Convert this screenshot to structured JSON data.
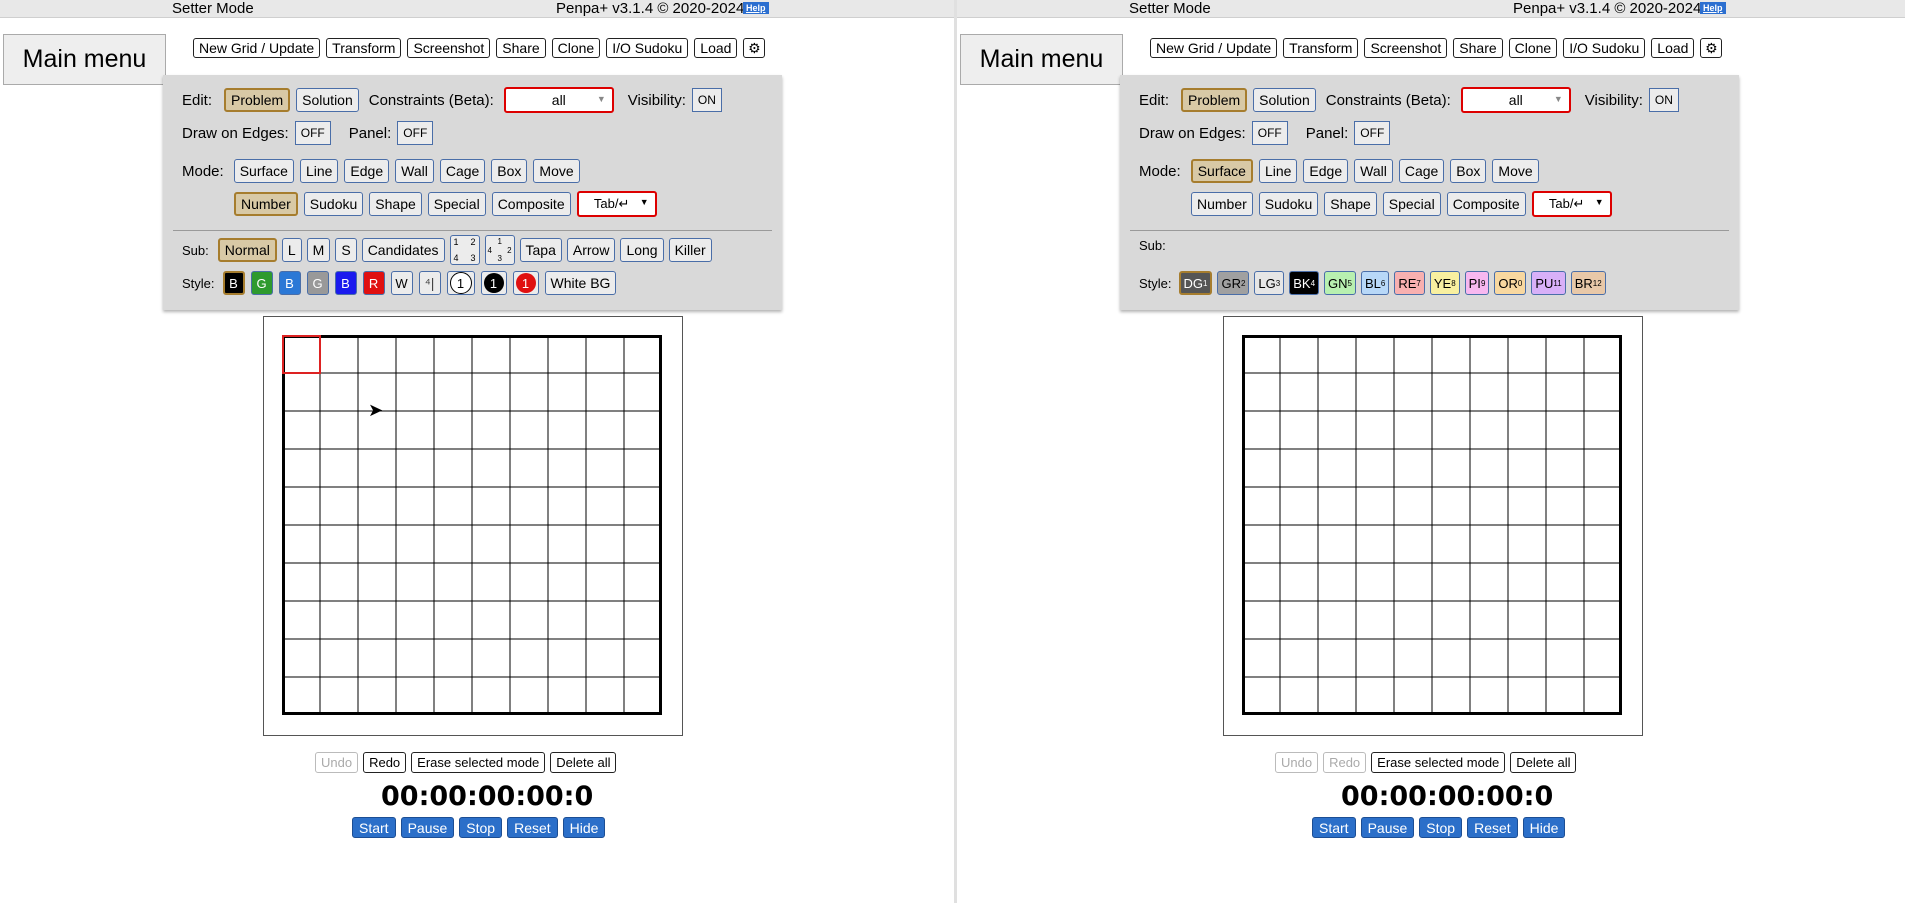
{
  "left": {
    "topbar": {
      "mode": "Setter Mode",
      "version": "Penpa+ v3.1.4 © 2020-2024",
      "help": "Help"
    },
    "main_menu": "Main menu",
    "toolbar": [
      "New Grid / Update",
      "Transform",
      "Screenshot",
      "Share",
      "Clone",
      "I/O Sudoku",
      "Load"
    ],
    "edit": {
      "label": "Edit:",
      "problem": "Problem",
      "solution": "Solution",
      "constraints_label": "Constraints (Beta):",
      "constraints_value": "all",
      "visibility_label": "Visibility:",
      "visibility_value": "ON"
    },
    "draw": {
      "label": "Draw on Edges:",
      "value": "OFF",
      "panel_label": "Panel:",
      "panel_value": "OFF"
    },
    "mode": {
      "label": "Mode:",
      "row1": [
        "Surface",
        "Line",
        "Edge",
        "Wall",
        "Cage",
        "Box",
        "Move"
      ],
      "row2": [
        "Number",
        "Sudoku",
        "Shape",
        "Special",
        "Composite"
      ],
      "tab": "Tab/↵",
      "selected": "Number"
    },
    "sub": {
      "label": "Sub:",
      "items": [
        "Normal",
        "L",
        "M",
        "S",
        "Candidates",
        "Tapa",
        "Arrow",
        "Long",
        "Killer"
      ],
      "selected": "Normal",
      "quad1": [
        "1",
        "2",
        "4",
        "3"
      ],
      "quad2": [
        "1",
        "4",
        "2",
        "3"
      ]
    },
    "style": {
      "label": "Style:",
      "items": [
        "B",
        "G",
        "B",
        "G",
        "B",
        "R",
        "W"
      ],
      "circle1": "1",
      "circle2": "1",
      "circle3": "1",
      "white_bg": "White BG"
    },
    "bottom": {
      "undo": "Undo",
      "redo": "Redo",
      "erase": "Erase selected mode",
      "delete": "Delete all"
    },
    "timer": "00:00:00:00:0",
    "timer_buttons": [
      "Start",
      "Pause",
      "Stop",
      "Reset",
      "Hide"
    ]
  },
  "right": {
    "topbar": {
      "mode": "Setter Mode",
      "version": "Penpa+ v3.1.4 © 2020-2024",
      "help": "Help"
    },
    "main_menu": "Main menu",
    "toolbar": [
      "New Grid / Update",
      "Transform",
      "Screenshot",
      "Share",
      "Clone",
      "I/O Sudoku",
      "Load"
    ],
    "edit": {
      "label": "Edit:",
      "problem": "Problem",
      "solution": "Solution",
      "constraints_label": "Constraints (Beta):",
      "constraints_value": "all",
      "visibility_label": "Visibility:",
      "visibility_value": "ON"
    },
    "draw": {
      "label": "Draw on Edges:",
      "value": "OFF",
      "panel_label": "Panel:",
      "panel_value": "OFF"
    },
    "mode": {
      "label": "Mode:",
      "row1": [
        "Surface",
        "Line",
        "Edge",
        "Wall",
        "Cage",
        "Box",
        "Move"
      ],
      "row2": [
        "Number",
        "Sudoku",
        "Shape",
        "Special",
        "Composite"
      ],
      "tab": "Tab/↵",
      "selected": "Surface"
    },
    "sub": {
      "label": "Sub:"
    },
    "style": {
      "label": "Style:",
      "swatches": [
        {
          "text": "DG",
          "num": "1",
          "bg": "#555555",
          "fg": "#ffffff"
        },
        {
          "text": "GR",
          "num": "2",
          "bg": "#a0a0a0",
          "fg": "#000000"
        },
        {
          "text": "LG",
          "num": "3",
          "bg": "#e6e6e6",
          "fg": "#000000"
        },
        {
          "text": "BK",
          "num": "4",
          "bg": "#000000",
          "fg": "#ffffff"
        },
        {
          "text": "GN",
          "num": "5",
          "bg": "#b8f0b0",
          "fg": "#000000"
        },
        {
          "text": "BL",
          "num": "6",
          "bg": "#b8d8f8",
          "fg": "#000000"
        },
        {
          "text": "RE",
          "num": "7",
          "bg": "#f8b0b0",
          "fg": "#000000"
        },
        {
          "text": "YE",
          "num": "8",
          "bg": "#f8f0a0",
          "fg": "#000000"
        },
        {
          "text": "PI",
          "num": "9",
          "bg": "#f8b8f0",
          "fg": "#000000"
        },
        {
          "text": "OR",
          "num": "0",
          "bg": "#f8d8a0",
          "fg": "#000000"
        },
        {
          "text": "PU",
          "num": "11",
          "bg": "#d8b0f8",
          "fg": "#000000"
        },
        {
          "text": "BR",
          "num": "12",
          "bg": "#e8c8a8",
          "fg": "#000000"
        }
      ]
    },
    "bottom": {
      "undo": "Undo",
      "redo": "Redo",
      "erase": "Erase selected mode",
      "delete": "Delete all"
    },
    "timer": "00:00:00:00:0",
    "timer_buttons": [
      "Start",
      "Pause",
      "Stop",
      "Reset",
      "Hide"
    ]
  },
  "grid": {
    "rows": 10,
    "cols": 10,
    "selected_cell": [
      0,
      0
    ]
  },
  "colors": {
    "accent": "#2b6fc9",
    "selected": "#d8c9a6",
    "panel": "#d9d9d9",
    "cell_highlight": "#dd2222"
  }
}
